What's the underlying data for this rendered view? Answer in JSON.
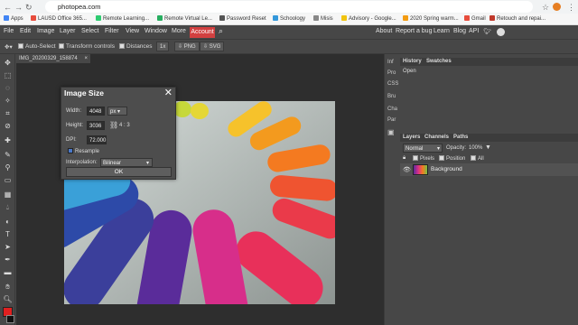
{
  "browser": {
    "url": "photopea.com",
    "bookmarks": [
      "Apps",
      "LAUSD Office 365...",
      "Remote Learning...",
      "Remote Virtual Le...",
      "Password Reset",
      "Schoology",
      "Misis",
      "Advisory - Google...",
      "2020 Spring warm...",
      "Gmail",
      "Retouch and repai..."
    ]
  },
  "menu": {
    "items": [
      "File",
      "Edit",
      "Image",
      "Layer",
      "Select",
      "Filter",
      "View",
      "Window",
      "More"
    ],
    "account": "Account",
    "right": [
      "About",
      "Report a bug",
      "Learn",
      "Blog",
      "API"
    ]
  },
  "options": {
    "auto_select": "Auto-Select",
    "transform_controls": "Transform controls",
    "distances": "Distances",
    "zoom": "1x",
    "png": "PNG",
    "svg": "SVG"
  },
  "document": {
    "tab": "IMG_20200329_158874"
  },
  "dialog": {
    "title": "Image Size",
    "width_label": "Width:",
    "width_value": "4048",
    "unit": "px",
    "height_label": "Height:",
    "height_value": "3036",
    "ratio": "4 : 3",
    "dpi_label": "DPI:",
    "dpi_value": "72.000",
    "resample": "Resample",
    "interp_label": "Interpolation:",
    "interp_value": "Bilinear",
    "ok": "OK"
  },
  "mini_panels": [
    "Inf",
    "Pro",
    "CSS",
    "Bru",
    "Cha",
    "Par"
  ],
  "history": {
    "tabs": [
      "History",
      "Swatches"
    ],
    "items": [
      "Open"
    ]
  },
  "layers": {
    "tabs": [
      "Layers",
      "Channels",
      "Paths"
    ],
    "blend": "Normal",
    "opacity_label": "Opacity:",
    "opacity": "100%",
    "lock_pixels": "Pixels",
    "lock_position": "Position",
    "lock_all": "All",
    "layer_name": "Background"
  },
  "colors": {
    "accent": "#d24040",
    "bg": "#474747"
  }
}
